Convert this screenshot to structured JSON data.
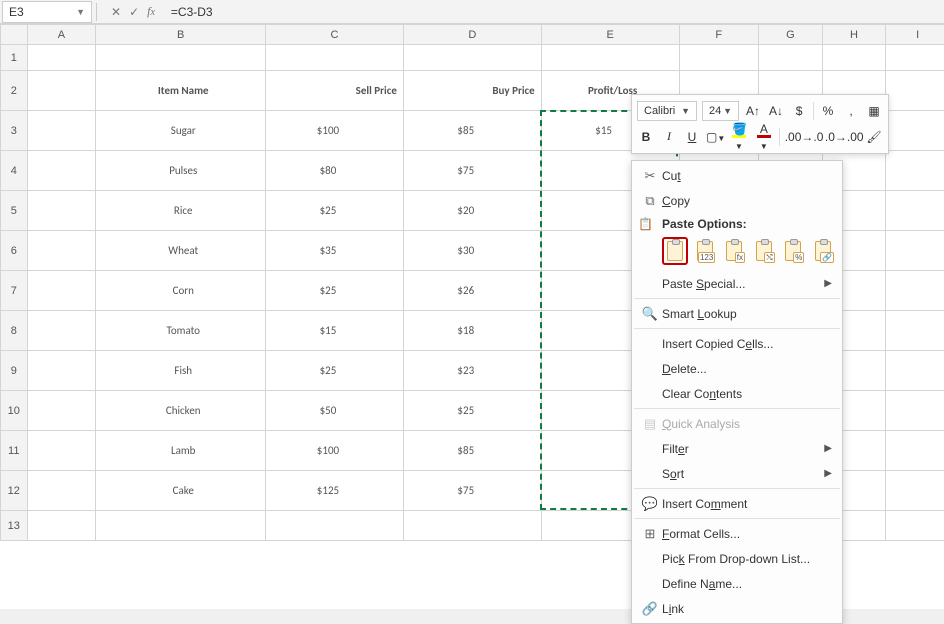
{
  "namebox": "E3",
  "formula": "=C3-D3",
  "columns": [
    "A",
    "B",
    "C",
    "D",
    "E",
    "F",
    "G",
    "H",
    "I"
  ],
  "headers": {
    "b": "Item Name",
    "c": "Sell Price",
    "d": "Buy Price",
    "e": "Profit/Loss"
  },
  "rows": [
    {
      "item": "Sugar",
      "sell": "$100",
      "buy": "$85",
      "profit": "$15"
    },
    {
      "item": "Pulses",
      "sell": "$80",
      "buy": "$75",
      "profit": ""
    },
    {
      "item": "Rice",
      "sell": "$25",
      "buy": "$20",
      "profit": ""
    },
    {
      "item": "Wheat",
      "sell": "$35",
      "buy": "$30",
      "profit": ""
    },
    {
      "item": "Corn",
      "sell": "$25",
      "buy": "$26",
      "profit": ""
    },
    {
      "item": "Tomato",
      "sell": "$15",
      "buy": "$18",
      "profit": ""
    },
    {
      "item": "Fish",
      "sell": "$25",
      "buy": "$23",
      "profit": ""
    },
    {
      "item": "Chicken",
      "sell": "$50",
      "buy": "$25",
      "profit": ""
    },
    {
      "item": "Lamb",
      "sell": "$100",
      "buy": "$85",
      "profit": ""
    },
    {
      "item": "Cake",
      "sell": "$125",
      "buy": "$75",
      "profit": ""
    }
  ],
  "miniToolbar": {
    "font": "Calibri",
    "size": "24",
    "currency": "$",
    "percent": "%",
    "comma": ","
  },
  "ctx": {
    "cut": "Cut",
    "copy": "Copy",
    "pasteOptionsHeader": "Paste Options:",
    "pasteSpecial": "Paste Special...",
    "smartLookup": "Smart Lookup",
    "insertCopied": "Insert Copied Cells...",
    "delete": "Delete...",
    "clearContents": "Clear Contents",
    "quickAnalysis": "Quick Analysis",
    "filter": "Filter",
    "sort": "Sort",
    "insertComment": "Insert Comment",
    "formatCells": "Format Cells...",
    "pickDropdown": "Pick From Drop-down List...",
    "defineName": "Define Name...",
    "link": "Link"
  },
  "pasteOptionNames": [
    "paste",
    "values",
    "formulas",
    "transpose",
    "formatting",
    "link"
  ],
  "pasteOptionBadges": [
    "",
    "123",
    "fx",
    "⤭",
    "%",
    "🔗"
  ],
  "chart_data": {
    "type": "table",
    "title": "Item Profit/Loss",
    "columns": [
      "Item Name",
      "Sell Price",
      "Buy Price",
      "Profit/Loss"
    ],
    "rows": [
      [
        "Sugar",
        100,
        85,
        15
      ],
      [
        "Pulses",
        80,
        75,
        null
      ],
      [
        "Rice",
        25,
        20,
        null
      ],
      [
        "Wheat",
        35,
        30,
        null
      ],
      [
        "Corn",
        25,
        26,
        null
      ],
      [
        "Tomato",
        15,
        18,
        null
      ],
      [
        "Fish",
        25,
        23,
        null
      ],
      [
        "Chicken",
        50,
        25,
        null
      ],
      [
        "Lamb",
        100,
        85,
        null
      ],
      [
        "Cake",
        125,
        75,
        null
      ]
    ]
  }
}
